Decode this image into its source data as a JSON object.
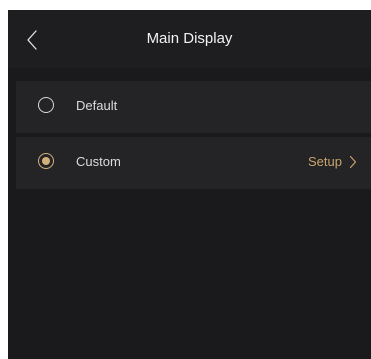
{
  "header": {
    "title": "Main Display",
    "back_icon": "chevron-left-icon"
  },
  "options": [
    {
      "label": "Default",
      "selected": false
    },
    {
      "label": "Custom",
      "selected": true,
      "action_label": "Setup",
      "action_icon": "chevron-right-icon"
    }
  ],
  "colors": {
    "background": "#1a1a1c",
    "header": "#1e1e20",
    "row": "#242426",
    "accent": "#d2b07a",
    "text": "#dcdcdc"
  }
}
